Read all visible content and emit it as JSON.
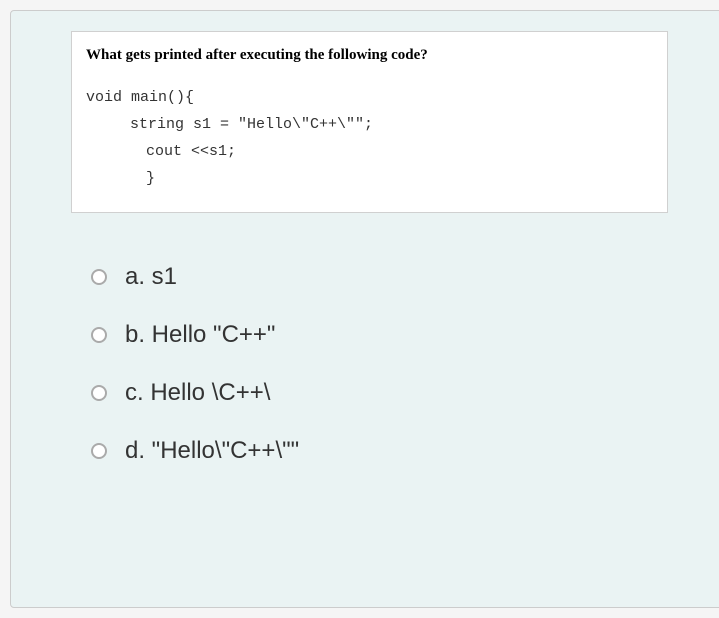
{
  "question": {
    "title": "What gets printed after executing the following code?",
    "code": {
      "line1": "void main(){",
      "line2": "string s1 = \"Hello\\\"C++\\\"\";",
      "line3": "cout <<s1;",
      "line4": "}"
    }
  },
  "options": {
    "a": "a. s1",
    "b": "b. Hello \"C++\"",
    "c": "c. Hello \\C++\\",
    "d": "d. \"Hello\\\"C++\\\"\""
  }
}
